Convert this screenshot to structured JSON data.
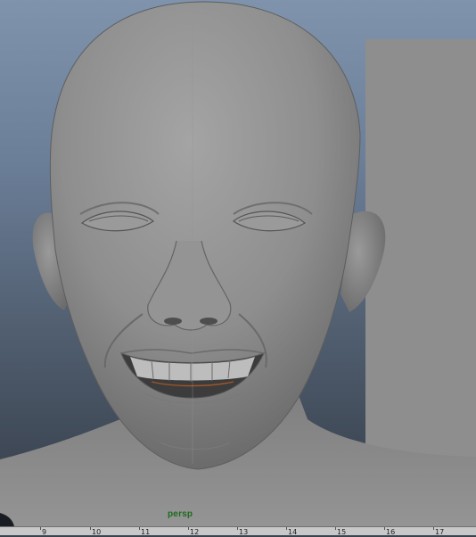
{
  "viewport": {
    "camera_label": "persp"
  },
  "timeslider": {
    "ticks": [
      "9",
      "10",
      "11",
      "12",
      "13",
      "14",
      "15",
      "16",
      "17"
    ]
  },
  "icons": {
    "model": "head-mesh-icon"
  },
  "colors": {
    "camera_label": "#1d6b1d",
    "background_top": "#7f93ad",
    "background_bottom": "#333b46",
    "mesh": "#8c8c8c"
  }
}
